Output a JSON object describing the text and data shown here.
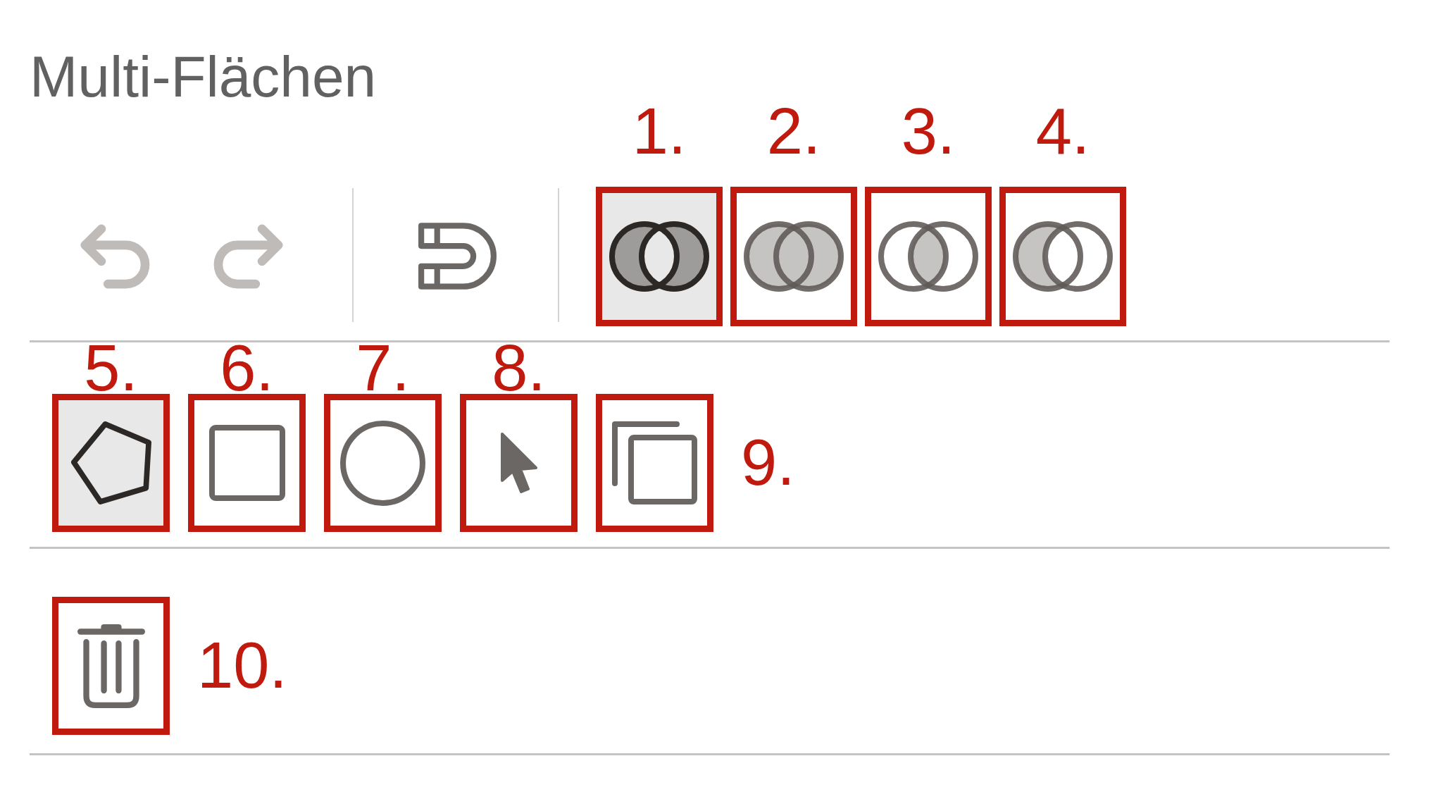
{
  "panel": {
    "title": "Multi-Flächen"
  },
  "toolbar": {
    "history": [
      {
        "kind": "undo",
        "disabled": true
      },
      {
        "kind": "redo",
        "disabled": true
      }
    ],
    "snap": {
      "disabled": false
    },
    "boolean_modes": [
      {
        "kind": "exclude",
        "selected": true,
        "callout": "1.",
        "callout_beside": false
      },
      {
        "kind": "unite",
        "selected": false,
        "callout": "2.",
        "callout_beside": false
      },
      {
        "kind": "intersect",
        "selected": false,
        "callout": "3.",
        "callout_beside": false
      },
      {
        "kind": "subtract",
        "selected": false,
        "callout": "4.",
        "callout_beside": false
      }
    ]
  },
  "shape_tools": [
    {
      "kind": "polygon",
      "selected": true,
      "callout": "5.",
      "callout_beside": false
    },
    {
      "kind": "rectangle",
      "selected": false,
      "callout": "6.",
      "callout_beside": false
    },
    {
      "kind": "circle",
      "selected": false,
      "callout": "7.",
      "callout_beside": false
    },
    {
      "kind": "pointer",
      "selected": false,
      "callout": "8.",
      "callout_beside": false
    },
    {
      "kind": "duplicate",
      "selected": false,
      "callout": "9.",
      "callout_beside": true
    }
  ],
  "actions": [
    {
      "kind": "delete",
      "callout": "10.",
      "callout_beside": true
    }
  ]
}
